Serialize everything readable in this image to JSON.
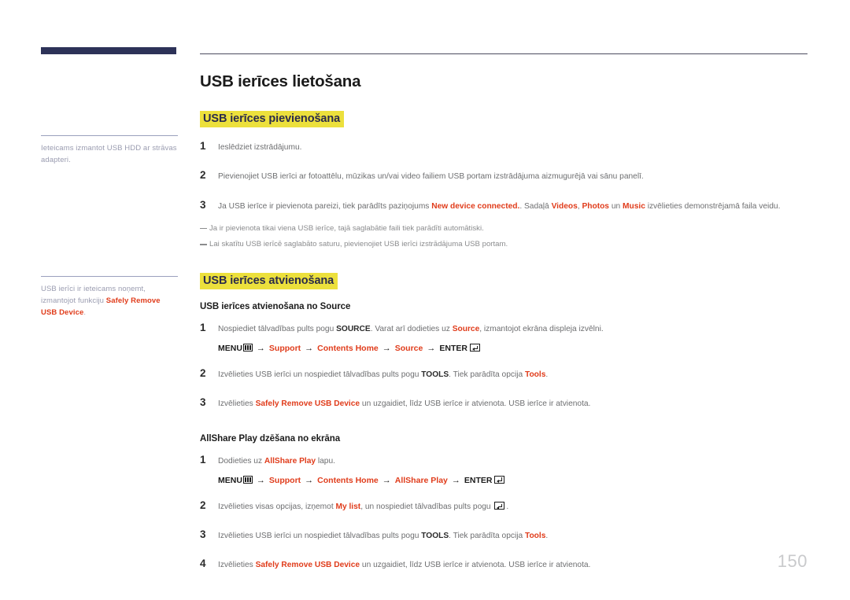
{
  "document": {
    "page_number": "150",
    "title": "USB ierīces lietošana"
  },
  "colors": {
    "brand_bar": "#2d3258",
    "highlight": "#ece03c",
    "accent_red": "#e03c1b",
    "body_text": "#6d6e70",
    "side_note": "#9a9cb0"
  },
  "sidebar": {
    "notes": [
      {
        "text_before": "Ieteicams izmantot USB HDD ar strāvas adapteri.",
        "bold": "",
        "text_after": ""
      },
      {
        "text_before": "USB ierīci ir ieteicams noņemt, izmantojot funkciju ",
        "bold": "Safely Remove USB Device",
        "text_after": "."
      }
    ]
  },
  "sections": {
    "connect": {
      "heading": "USB ierīces pievienošana",
      "steps": [
        {
          "num": "1",
          "parts": [
            {
              "type": "plain",
              "text": "Ieslēdziet izstrādājumu."
            }
          ]
        },
        {
          "num": "2",
          "parts": [
            {
              "type": "plain",
              "text": "Pievienojiet USB ierīci ar fotoattēlu, mūzikas un/vai video failiem USB portam izstrādājuma aizmugurējā vai sānu panelī."
            }
          ]
        },
        {
          "num": "3",
          "parts": [
            {
              "type": "plain",
              "text": "Ja USB ierīce ir pievienota pareizi, tiek parādīts paziņojums "
            },
            {
              "type": "red",
              "text": "New device connected."
            },
            {
              "type": "plain",
              "text": ". Sadaļā "
            },
            {
              "type": "red",
              "text": "Videos"
            },
            {
              "type": "plain",
              "text": ", "
            },
            {
              "type": "red",
              "text": "Photos"
            },
            {
              "type": "plain",
              "text": " un "
            },
            {
              "type": "red",
              "text": "Music"
            },
            {
              "type": "plain",
              "text": " izvēlieties demonstrējamā faila veidu."
            }
          ]
        }
      ],
      "notes": [
        "Ja ir pievienota tikai viena USB ierīce, tajā saglabātie faili tiek parādīti automātiski.",
        "Lai skatītu USB ierīcē saglabāto saturu, pievienojiet USB ierīci izstrādājuma USB portam."
      ]
    },
    "disconnect": {
      "heading": "USB ierīces atvienošana",
      "subsections": [
        {
          "title": "USB ierīces atvienošana no Source",
          "steps": [
            {
              "num": "1",
              "parts": [
                {
                  "type": "plain",
                  "text": "Nospiediet tālvadības pults pogu "
                },
                {
                  "type": "bold",
                  "text": "SOURCE"
                },
                {
                  "type": "plain",
                  "text": ". Varat arī dodieties uz "
                },
                {
                  "type": "red",
                  "text": "Source"
                },
                {
                  "type": "plain",
                  "text": ", izmantojot ekrāna displeja izvēlni."
                }
              ],
              "menu_path": {
                "menu_label": "MENU",
                "menu_icon": "menu-bars-icon",
                "items": [
                  {
                    "label": "Support",
                    "color": "red"
                  },
                  {
                    "label": "Contents Home",
                    "color": "red"
                  },
                  {
                    "label": "Source",
                    "color": "red"
                  }
                ],
                "enter_label": "ENTER",
                "enter_icon": "enter-key-icon",
                "arrow": "→"
              }
            },
            {
              "num": "2",
              "parts": [
                {
                  "type": "plain",
                  "text": "Izvēlieties USB ierīci un nospiediet tālvadības pults pogu "
                },
                {
                  "type": "bold",
                  "text": "TOOLS"
                },
                {
                  "type": "plain",
                  "text": ". Tiek parādīta opcija "
                },
                {
                  "type": "red",
                  "text": "Tools"
                },
                {
                  "type": "plain",
                  "text": "."
                }
              ]
            },
            {
              "num": "3",
              "parts": [
                {
                  "type": "plain",
                  "text": "Izvēlieties "
                },
                {
                  "type": "red",
                  "text": "Safely Remove USB Device"
                },
                {
                  "type": "plain",
                  "text": " un uzgaidiet, līdz USB ierīce ir atvienota. USB ierīce ir atvienota."
                }
              ]
            }
          ]
        },
        {
          "title": "AllShare Play dzēšana no ekrāna",
          "steps": [
            {
              "num": "1",
              "parts": [
                {
                  "type": "plain",
                  "text": "Dodieties uz "
                },
                {
                  "type": "red",
                  "text": "AllShare Play"
                },
                {
                  "type": "plain",
                  "text": " lapu."
                }
              ],
              "menu_path": {
                "menu_label": "MENU",
                "menu_icon": "menu-bars-icon",
                "items": [
                  {
                    "label": "Support",
                    "color": "red"
                  },
                  {
                    "label": "Contents Home",
                    "color": "red"
                  },
                  {
                    "label": "AllShare Play",
                    "color": "red"
                  }
                ],
                "enter_label": "ENTER",
                "enter_icon": "enter-key-icon",
                "arrow": "→"
              }
            },
            {
              "num": "2",
              "parts": [
                {
                  "type": "plain",
                  "text": "Izvēlieties visas opcijas, izņemot "
                },
                {
                  "type": "red",
                  "text": "My list"
                },
                {
                  "type": "plain",
                  "text": ", un nospiediet tālvadības pults pogu "
                },
                {
                  "type": "enter-icon",
                  "text": ""
                },
                {
                  "type": "plain",
                  "text": "."
                }
              ]
            },
            {
              "num": "3",
              "parts": [
                {
                  "type": "plain",
                  "text": "Izvēlieties USB ierīci un nospiediet tālvadības pults pogu "
                },
                {
                  "type": "bold",
                  "text": "TOOLS"
                },
                {
                  "type": "plain",
                  "text": ". Tiek parādīta opcija "
                },
                {
                  "type": "red",
                  "text": "Tools"
                },
                {
                  "type": "plain",
                  "text": "."
                }
              ]
            },
            {
              "num": "4",
              "parts": [
                {
                  "type": "plain",
                  "text": "Izvēlieties "
                },
                {
                  "type": "red",
                  "text": "Safely Remove USB Device"
                },
                {
                  "type": "plain",
                  "text": " un uzgaidiet, līdz USB ierīce ir atvienota. USB ierīce ir atvienota."
                }
              ]
            }
          ]
        }
      ]
    }
  }
}
